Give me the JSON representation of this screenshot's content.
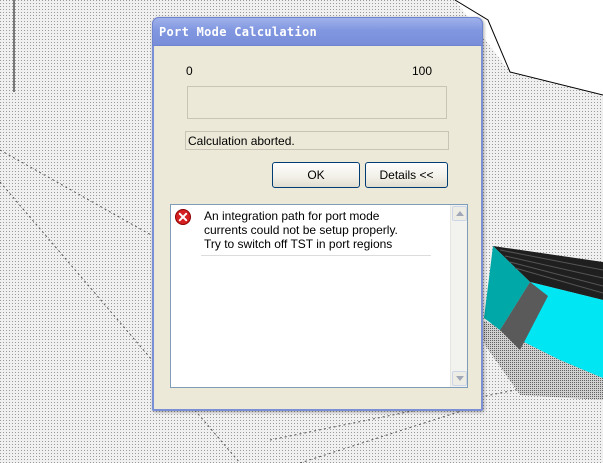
{
  "dialog": {
    "title": "Port Mode Calculation",
    "progress_min_label": "0",
    "progress_max_label": "100",
    "progress_value": 0,
    "status_text": "Calculation aborted.",
    "ok_label": "OK",
    "details_label": "Details <<"
  },
  "message": {
    "icon": "error-icon",
    "lines": [
      "An integration path for port mode",
      "currents could not be setup properly.",
      "Try to switch off TST in port regions"
    ]
  },
  "colors": {
    "title_bar": "#8197e0",
    "dialog_bg": "#ece9d8",
    "error_red": "#d42020",
    "solid_teal": "#00a8a8",
    "solid_cyan": "#00e6f2"
  }
}
